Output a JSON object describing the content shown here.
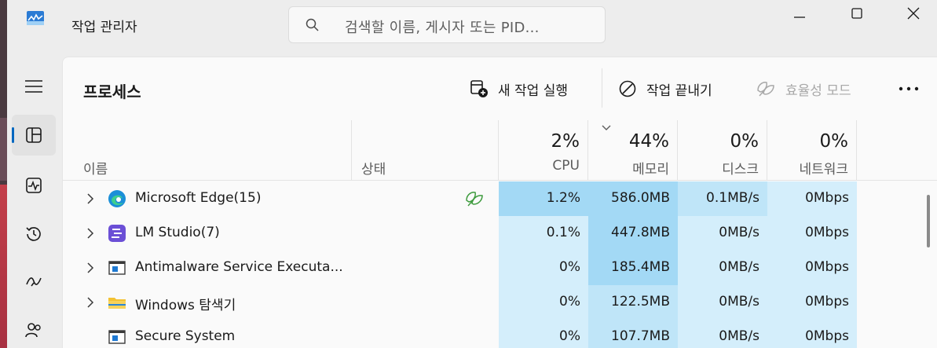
{
  "window": {
    "title": "작업 관리자",
    "search_placeholder": "검색할 이름, 게시자 또는 PID..."
  },
  "nav": {
    "items": [
      {
        "icon": "hamburger-icon",
        "active": false
      },
      {
        "icon": "processes-icon",
        "active": true
      },
      {
        "icon": "performance-icon",
        "active": false
      },
      {
        "icon": "app-history-icon",
        "active": false
      },
      {
        "icon": "startup-apps-icon",
        "active": false
      },
      {
        "icon": "users-icon",
        "active": false
      }
    ]
  },
  "toolbar": {
    "page_title": "프로세스",
    "run_new_task": "새 작업 실행",
    "end_task": "작업 끝내기",
    "efficiency_mode": "효율성 모드"
  },
  "columns": {
    "name": "이름",
    "status": "상태",
    "cpu": {
      "pct": "2%",
      "label": "CPU"
    },
    "memory": {
      "pct": "44%",
      "label": "메모리"
    },
    "disk": {
      "pct": "0%",
      "label": "디스크"
    },
    "network": {
      "pct": "0%",
      "label": "네트워크"
    }
  },
  "processes": [
    {
      "name": "Microsoft Edge(15)",
      "icon": "edge-icon",
      "expandable": true,
      "efficiency": true,
      "cpu": "1.2%",
      "memory": "586.0MB",
      "disk": "0.1MB/s",
      "network": "0Mbps"
    },
    {
      "name": "LM Studio(7)",
      "icon": "lm-studio-icon",
      "expandable": true,
      "efficiency": false,
      "cpu": "0.1%",
      "memory": "447.8MB",
      "disk": "0MB/s",
      "network": "0Mbps"
    },
    {
      "name": "Antimalware Service Executa...",
      "icon": "service-window-icon",
      "expandable": true,
      "efficiency": false,
      "cpu": "0%",
      "memory": "185.4MB",
      "disk": "0MB/s",
      "network": "0Mbps"
    },
    {
      "name": "Windows 탐색기",
      "icon": "folder-icon",
      "expandable": true,
      "efficiency": false,
      "cpu": "0%",
      "memory": "122.5MB",
      "disk": "0MB/s",
      "network": "0Mbps"
    },
    {
      "name": "Secure System",
      "icon": "service-window-icon",
      "expandable": false,
      "efficiency": false,
      "cpu": "0%",
      "memory": "107.7MB",
      "disk": "0MB/s",
      "network": "0Mbps"
    }
  ],
  "colors": {
    "heat_light": "#d4eefb",
    "heat_mid": "#bfe5f8",
    "heat_strong": "#a3d9f5",
    "accent": "#0067c0",
    "efficiency_green": "#3e9b3e"
  }
}
